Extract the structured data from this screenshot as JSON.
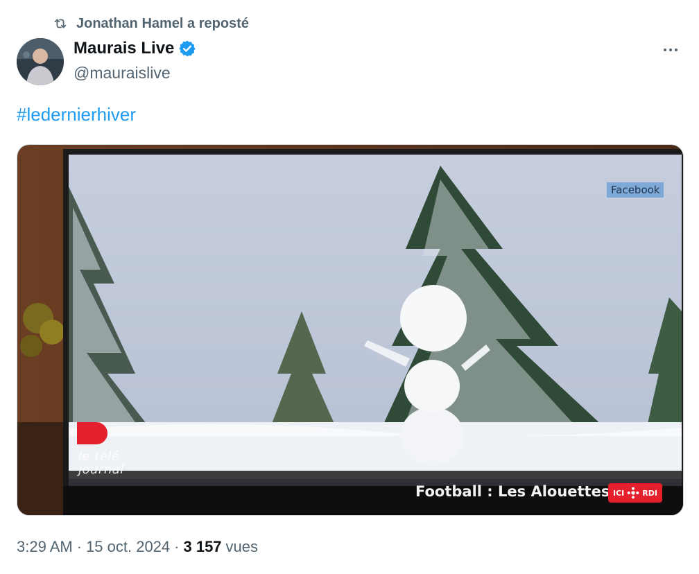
{
  "repost": {
    "icon": "repost-icon",
    "text": "Jonathan Hamel a reposté"
  },
  "author": {
    "name": "Maurais Live",
    "handle": "@mauraislive",
    "verified": true,
    "verified_color": "#1d9bf0"
  },
  "more_menu": {
    "icon": "more-horizontal-icon"
  },
  "tweet": {
    "hashtag": "#ledernierhiver"
  },
  "media": {
    "overlay_label": "Facebook",
    "ticker_text": "Football : Les Alouettes d",
    "channel_badge": {
      "left": "ICI",
      "right": "RDI",
      "color": "#e4202c"
    },
    "show_logo": {
      "line1": "le télé",
      "line2": "journal",
      "color": "#e4202c"
    }
  },
  "meta": {
    "time": "3:29 AM",
    "separator": "·",
    "date": "15 oct. 2024",
    "views_count": "3 157",
    "views_label": "vues"
  },
  "colors": {
    "accent": "#1d9bf0",
    "secondary_text": "#536471",
    "primary_text": "#0f1419"
  }
}
